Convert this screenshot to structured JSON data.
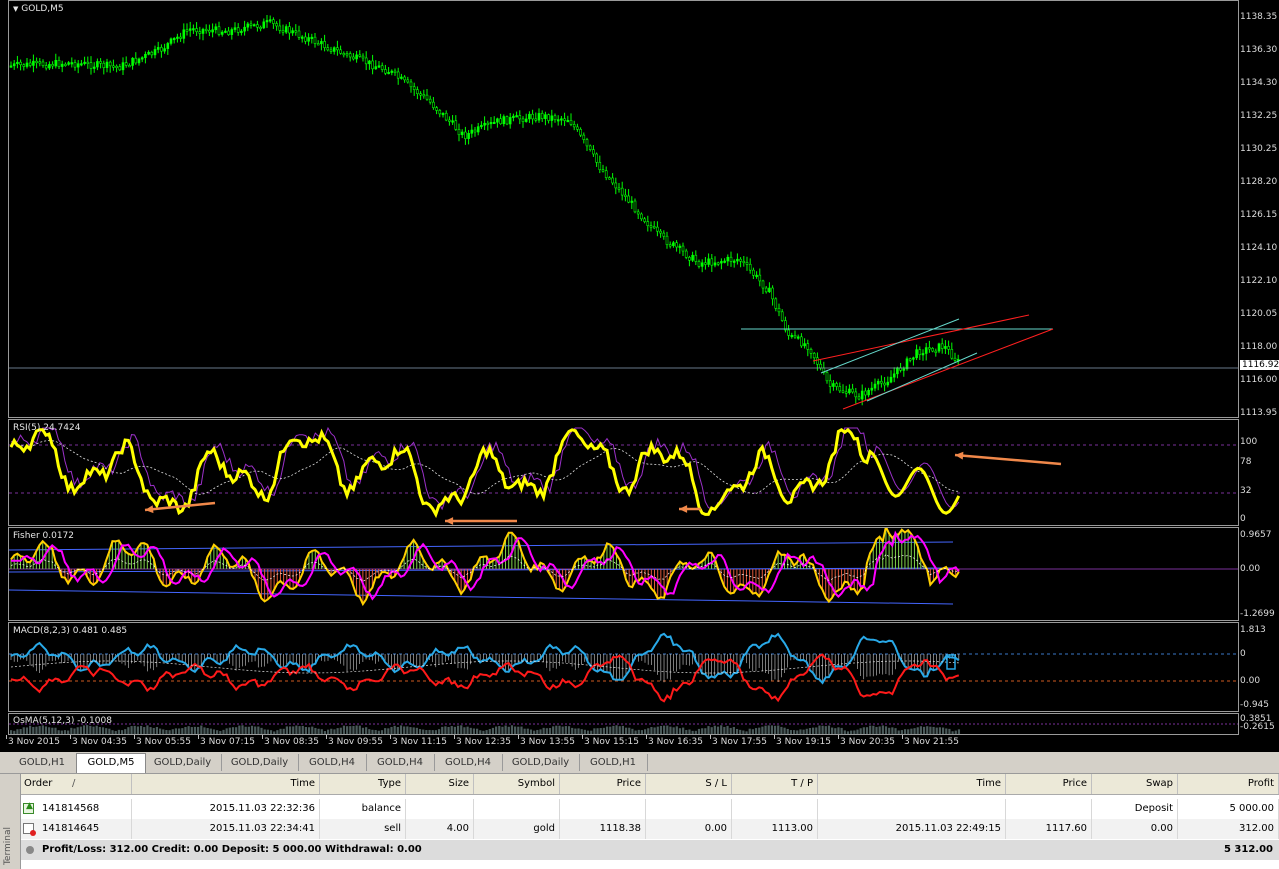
{
  "chart": {
    "main_title": "GOLD,M5",
    "current_price": "1116.92",
    "price_scale": [
      "1138.35",
      "1136.30",
      "1134.30",
      "1132.25",
      "1130.25",
      "1128.20",
      "1126.15",
      "1124.10",
      "1122.10",
      "1120.05",
      "1118.00",
      "1116.00",
      "1113.95"
    ],
    "rsi": {
      "title": "RSI(5) 24.7424",
      "scale": [
        "100",
        "78",
        "32",
        "0"
      ]
    },
    "fisher": {
      "title": "Fisher 0.0172",
      "scale": [
        "0.9657",
        "0.00",
        "-1.2699"
      ]
    },
    "macd": {
      "title": "MACD(8,2,3) 0.481 0.485",
      "scale": [
        "1.813",
        "0",
        "0.00",
        "-0.945"
      ]
    },
    "osma": {
      "title": "OsMA(5,12,3) -0.1008",
      "scale": [
        "0.3851",
        "-0.2615"
      ]
    },
    "time_axis": [
      "3 Nov 2015",
      "3 Nov 04:35",
      "3 Nov 05:55",
      "3 Nov 07:15",
      "3 Nov 08:35",
      "3 Nov 09:55",
      "3 Nov 11:15",
      "3 Nov 12:35",
      "3 Nov 13:55",
      "3 Nov 15:15",
      "3 Nov 16:35",
      "3 Nov 17:55",
      "3 Nov 19:15",
      "3 Nov 20:35",
      "3 Nov 21:55"
    ],
    "colors": {
      "candles": "#00ff00",
      "rsi": "#ffff00",
      "signal": "#9b30c9",
      "fisher_main": "#ff00ff",
      "macd_main": "#29a9e8",
      "macd_signal": "#ff1a1a",
      "arrow": "#f0884a",
      "band": "#4466ff",
      "hline": "#66d9cc"
    }
  },
  "tabs": [
    {
      "label": "GOLD,H1"
    },
    {
      "label": "GOLD,M5"
    },
    {
      "label": "GOLD,Daily"
    },
    {
      "label": "GOLD,Daily"
    },
    {
      "label": "GOLD,H4"
    },
    {
      "label": "GOLD,H4"
    },
    {
      "label": "GOLD,H4"
    },
    {
      "label": "GOLD,Daily"
    },
    {
      "label": "GOLD,H1"
    }
  ],
  "active_tab": "GOLD,M5",
  "terminal": {
    "side_label": "Terminal",
    "headers": {
      "order": "Order",
      "time": "Time",
      "type": "Type",
      "size": "Size",
      "symbol": "Symbol",
      "price": "Price",
      "sl": "S / L",
      "tp": "T / P",
      "time2": "Time",
      "price2": "Price",
      "swap": "Swap",
      "profit": "Profit"
    },
    "rows": [
      {
        "order": "141814568",
        "time": "2015.11.03 22:32:36",
        "type": "balance",
        "size": "",
        "symbol": "",
        "price": "",
        "sl": "",
        "tp": "",
        "time2": "",
        "price2": "",
        "swap": "Deposit",
        "profit": "5 000.00"
      },
      {
        "order": "141814645",
        "time": "2015.11.03 22:34:41",
        "type": "sell",
        "size": "4.00",
        "symbol": "gold",
        "price": "1118.38",
        "sl": "0.00",
        "tp": "1113.00",
        "time2": "2015.11.03 22:49:15",
        "price2": "1117.60",
        "swap": "0.00",
        "profit": "312.00"
      }
    ],
    "summary_text": "Profit/Loss: 312.00  Credit: 0.00  Deposit: 5 000.00  Withdrawal: 0.00",
    "summary_total": "5 312.00"
  }
}
